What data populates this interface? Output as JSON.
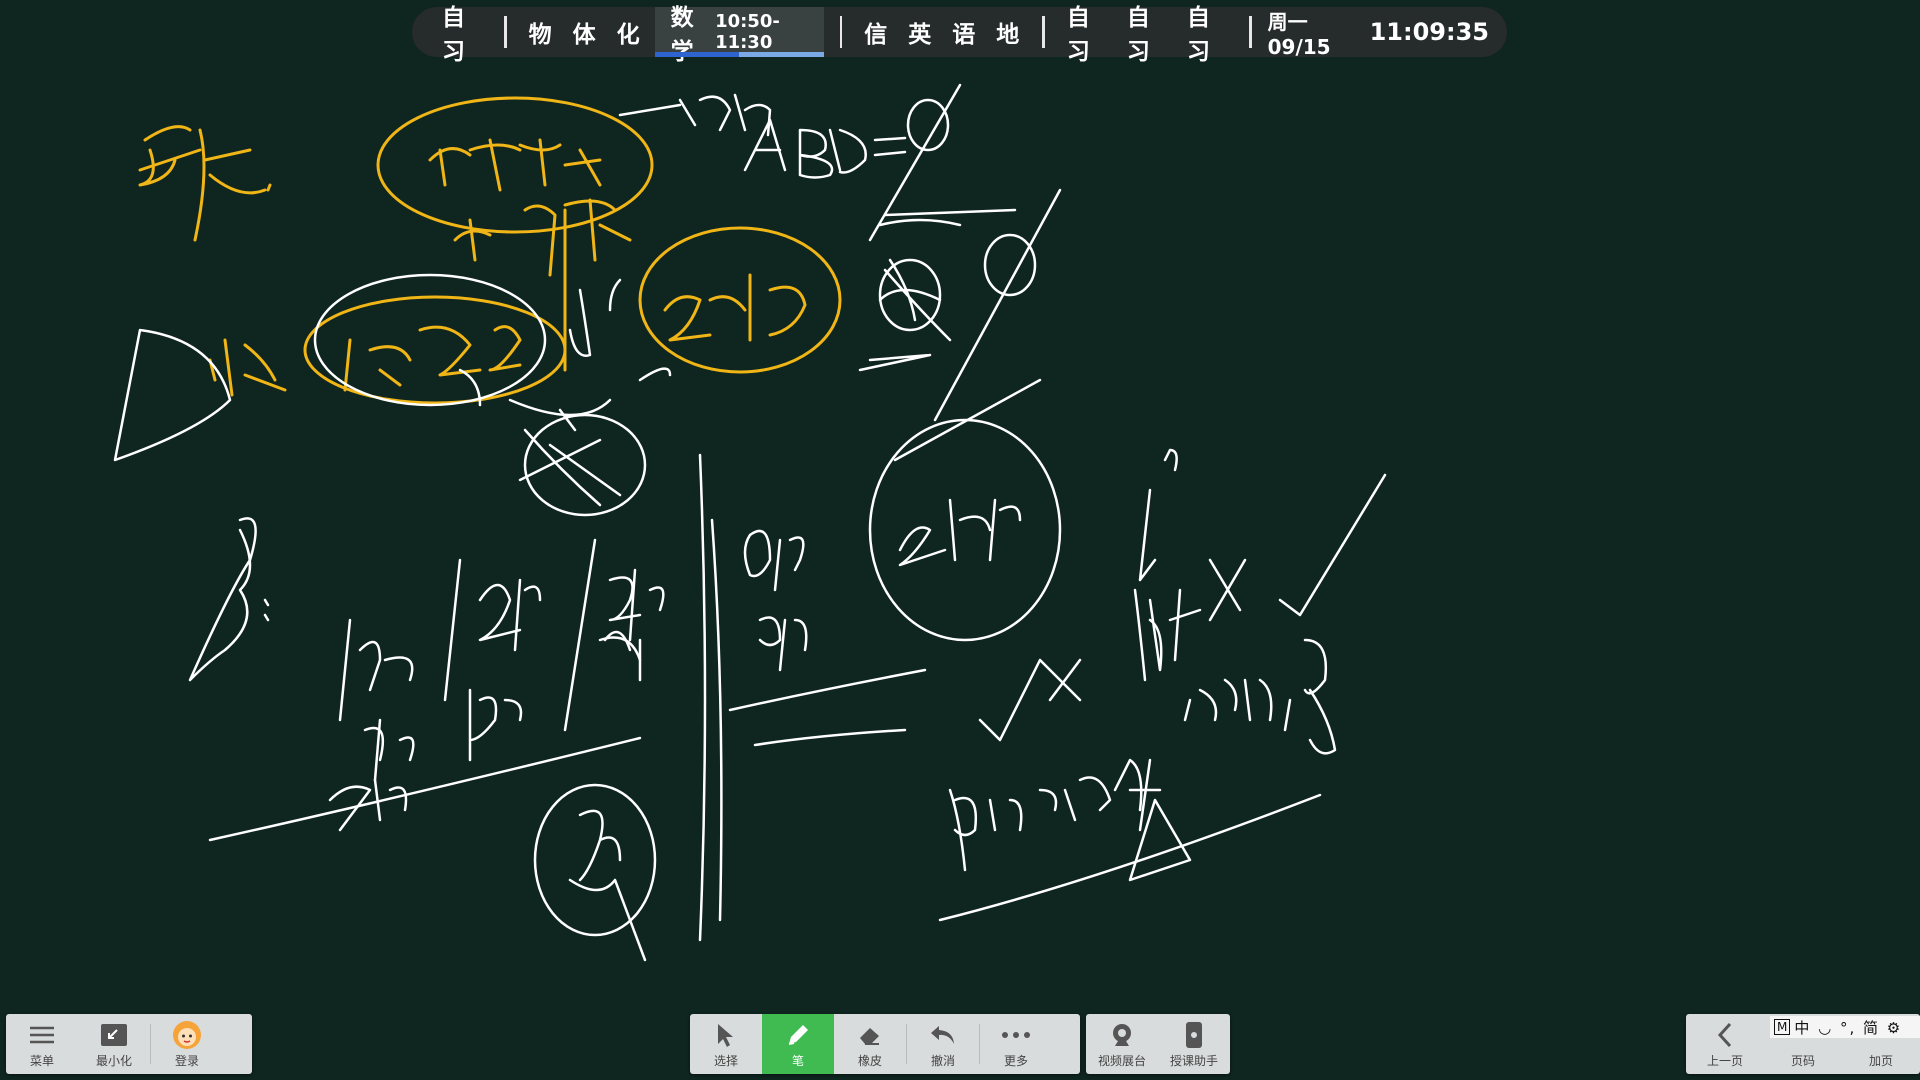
{
  "schedule": {
    "group1": [
      "自习"
    ],
    "group2_before": [
      "物",
      "体",
      "化"
    ],
    "current": {
      "subject": "数学",
      "time": "10:50-11:30",
      "progress": 0.5
    },
    "group3": [
      "信",
      "英",
      "语",
      "地"
    ],
    "group4": [
      "自习",
      "自习",
      "自习"
    ],
    "date": "周一 09/15",
    "clock": "11:09:35"
  },
  "toolbar_left": {
    "menu": "菜单",
    "minimize": "最小化",
    "login": "登录"
  },
  "toolbar_center": {
    "select": "选择",
    "pen": "笔",
    "eraser": "橡皮",
    "undo": "撤消",
    "more": "更多"
  },
  "toolbar_video": {
    "video": "视频展台",
    "assistant": "授课助手"
  },
  "toolbar_right": {
    "prev": "上一页",
    "page": "页码",
    "add": "加页"
  },
  "ime": {
    "mode": "M",
    "text": "中 ◡ °, 简 ⚙"
  },
  "colors": {
    "ink_white": "#ffffff",
    "ink_yellow": "#f0b516",
    "board": "#0f2520",
    "pen_active": "#3fbb52"
  },
  "icons": {
    "menu": "hamburger-icon",
    "minimize": "minimize-icon",
    "login": "avatar-icon",
    "select": "cursor-icon",
    "pen": "pen-icon",
    "eraser": "eraser-icon",
    "undo": "undo-icon",
    "more": "more-icon",
    "video": "camera-icon",
    "assistant": "phone-icon",
    "prev": "chevron-left-icon"
  }
}
